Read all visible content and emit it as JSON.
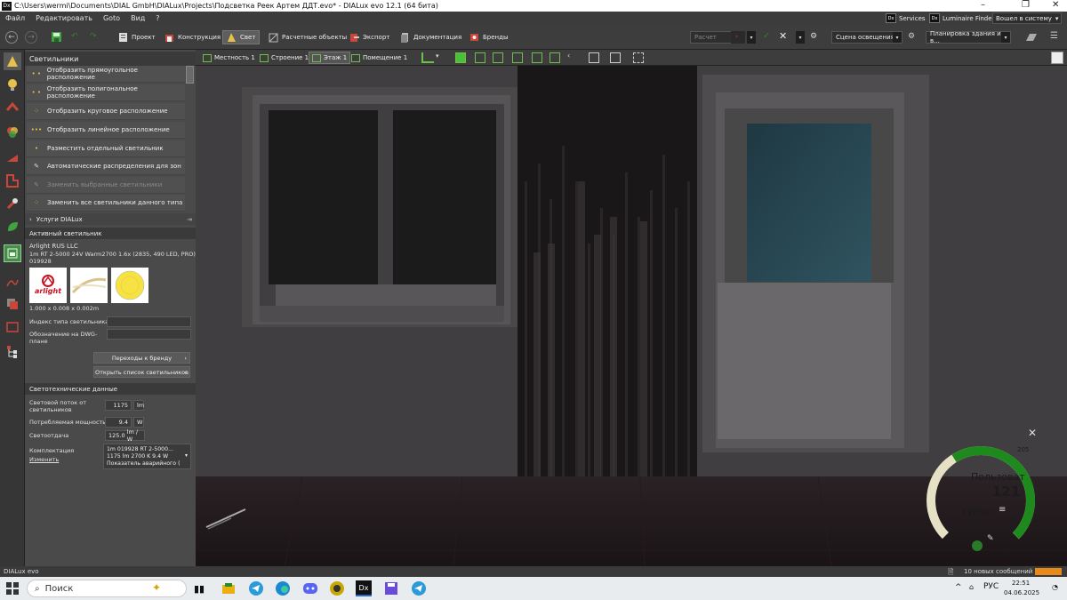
{
  "window": {
    "title": "C:\\Users\\wermi\\Documents\\DIAL GmbH\\DIALux\\Projects\\Подсветка Реек Артем ДДТ.evo* - DIALux evo 12.1  (64 бита)"
  },
  "menu": {
    "items": [
      "Файл",
      "Редактировать",
      "Goto",
      "Вид",
      "?"
    ],
    "services": "Services",
    "luminaire_finder": "Luminaire Finder",
    "login": "Вошел в систему"
  },
  "toolbar": {
    "tabs": [
      {
        "label": "Проект"
      },
      {
        "label": "Конструкция"
      },
      {
        "label": "Свет"
      },
      {
        "label": "Расчетные объекты"
      },
      {
        "label": "Экспорт"
      },
      {
        "label": "Документация"
      },
      {
        "label": "Бренды"
      }
    ],
    "calc_label": "Расчет",
    "scene_select": "Сцена освещения 1",
    "planning_select": "Планировка здания и в..."
  },
  "view_tabs": [
    "Местность 1",
    "Строение 1",
    "Этаж 1",
    "Помещение 1"
  ],
  "panel": {
    "luminaires_header": "Светильники",
    "luminaire_items": [
      {
        "label": "Отобразить прямоугольное расположение",
        "icon": "rect-arrangement-icon"
      },
      {
        "label": "Отобразить полигональное расположение",
        "icon": "polygon-arrangement-icon"
      },
      {
        "label": "Отобразить круговое расположение",
        "icon": "circular-arrangement-icon"
      },
      {
        "label": "Отобразить линейное расположение",
        "icon": "linear-arrangement-icon"
      },
      {
        "label": "Разместить отдельный светильник",
        "icon": "single-luminaire-icon"
      },
      {
        "label": "Автоматические распределения для зон",
        "icon": "auto-distribution-icon"
      },
      {
        "label": "Заменить выбранные светильники",
        "icon": "replace-selected-icon",
        "disabled": true
      },
      {
        "label": "Заменить все светильники данного типа",
        "icon": "replace-all-icon"
      }
    ],
    "services_header": "Услуги DIALux",
    "active_header": "Активный светильник",
    "manufacturer": "Arlight RUS LLC",
    "product": "1m RT 2-5000 24V Warm2700 1.6x (2835, 490 LED, PRO)",
    "article": "019928",
    "brand_logo": "arlight",
    "dimensions": "1.000 x 0.008 x 0.002m",
    "type_index_label": "Индекс типа светильника",
    "dwg_label": "Обозначение на DWG-плане",
    "btn_brand": "Переходы к бренду",
    "btn_list": "Открыть список светильников",
    "photometric_header": "Светотехнические данные",
    "flux_label": "Световой поток от светильников",
    "flux_value": "1175",
    "flux_unit": "lm",
    "power_label": "Потребляемая мощность",
    "power_value": "9.4",
    "power_unit": "W",
    "efficacy_label": "Светоотдача",
    "efficacy_value": "125.0",
    "efficacy_unit": "lm / W",
    "config_label": "Комплектация",
    "config_link": "Изменить",
    "config_lines": [
      "1m 019928 RT 2-5000...",
      "1175 lm   2700 K   9.4 W",
      "Показатель аварийного ("
    ]
  },
  "gauge": {
    "value": "121",
    "label_top": "Пользоват",
    "label_bottom": "kWh/a",
    "max_label": "205",
    "min_label": "65",
    "fill_fraction": 0.62,
    "color": "#1e8a1e"
  },
  "status": {
    "app": "DIALux evo",
    "messages": "10 новых сообщений"
  },
  "taskbar": {
    "search_placeholder": "Поиск",
    "lang": "РУС",
    "time": "22:51",
    "date": "04.06.2025"
  },
  "colors": {
    "accent_green": "#6fbf4a",
    "gauge_green": "#1e8a1e",
    "status_orange": "#e88a1a",
    "panel_bg": "#4a4a4a"
  }
}
